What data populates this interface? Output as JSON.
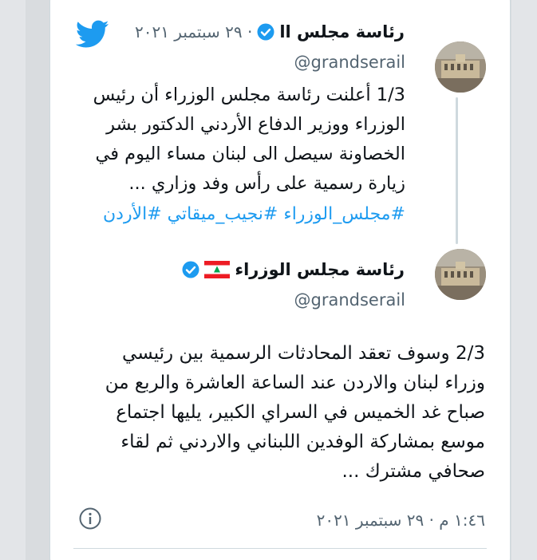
{
  "colors": {
    "text": "#0f1419",
    "secondary": "#536471",
    "link": "#1d9bf0",
    "verified": "#1d9bf0",
    "twitter_blue": "#1d9bf0"
  },
  "tweet1": {
    "author_name": "رئاسة مجلس اا",
    "date": "· ٢٩ سبتمبر ٢٠٢١",
    "handle": "@grandserail",
    "text": "1/3 أعلنت رئاسة مجلس الوزراء أن رئيس\nالوزراء ووزير الدفاع الأردني الدكتور بشر\nالخصاونة سيصل الى لبنان مساء اليوم في\nزيارة رسمية على رأس وفد وزاري ...",
    "hashtags": "#مجلس_الوزراء #نجيب_ميقاتي #الأردن",
    "icons": {
      "logo": "twitter-bird-icon",
      "badge": "verified-badge-icon"
    }
  },
  "tweet2": {
    "author_name": "رئاسة مجلس الوزراء",
    "handle": "@grandserail",
    "text": "2/3 وسوف تعقد المحادثات الرسمية بين رئيسي\nوزراء لبنان والاردن عند الساعة العاشرة والربع من\nصباح غد الخميس في السراي الكبير، يليها اجتماع\nموسع بمشاركة الوفدين اللبناني والاردني ثم لقاء\nصحافي مشترك ...",
    "timestamp": "١:٤٦ م · ٢٩ سبتمبر ٢٠٢١",
    "icons": {
      "flag": "lebanon-flag-icon",
      "badge": "verified-badge-icon",
      "info": "info-icon"
    }
  }
}
